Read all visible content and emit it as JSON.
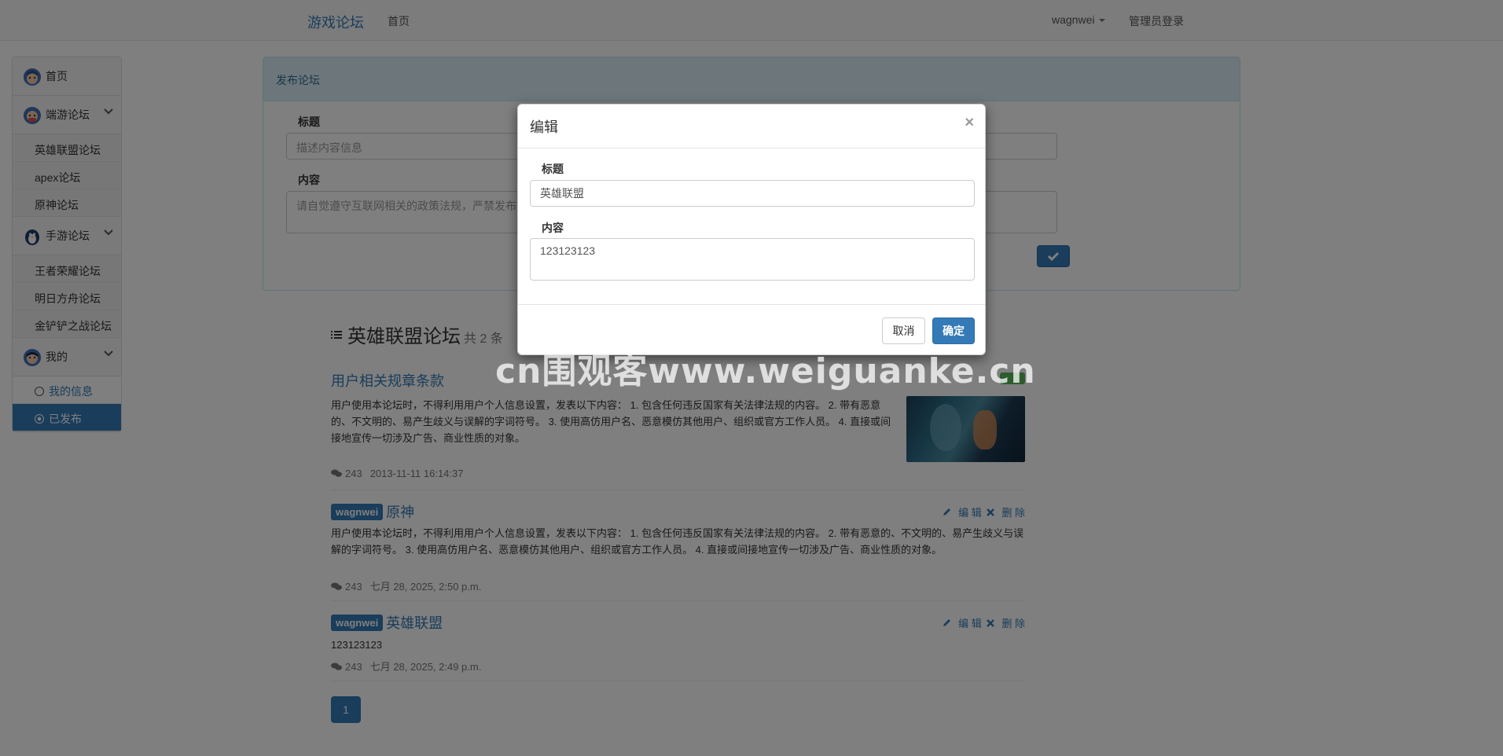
{
  "navbar": {
    "brand": "游戏论坛",
    "home": "首页",
    "user": "wagnwei",
    "admin_login": "管理员登录"
  },
  "sidebar": {
    "home": "首页",
    "pc_forum": "端游论坛",
    "pc_items": [
      "英雄联盟论坛",
      "apex论坛",
      "原神论坛"
    ],
    "mobile_forum": "手游论坛",
    "mobile_items": [
      "王者荣耀论坛",
      "明日方舟论坛",
      "金铲铲之战论坛"
    ],
    "mine": "我的",
    "mine_items": [
      "我的信息",
      "已发布"
    ]
  },
  "publish": {
    "header": "发布论坛",
    "title_label": "标题",
    "title_placeholder": "描述内容信息",
    "content_label": "内容",
    "content_placeholder": "请自觉遵守互联网相关的政策法规，严禁发布"
  },
  "list": {
    "title": "英雄联盟论坛",
    "count": "共 2 条",
    "posts": [
      {
        "title": "用户相关规章条款",
        "body": "用户使用本论坛时，不得利用用户个人信息设置，发表以下内容：   1. 包含任何违反国家有关法律法规的内容。    2. 带有恶意的、不文明的、易产生歧义与误解的字词符号。    3. 使用高仿用户名、恶意模仿其他用户、组织或官方工作人员。    4. 直接或间接地宣传一切涉及广告、商业性质的对象。",
        "comments": "243",
        "time": "2013-11-11 16:14:37"
      },
      {
        "author": "wagnwei",
        "title": "原神",
        "body": "用户使用本论坛时，不得利用用户个人信息设置，发表以下内容：   1. 包含任何违反国家有关法律法规的内容。    2. 带有恶意的、不文明的、易产生歧义与误解的字词符号。    3. 使用高仿用户名、恶意模仿其他用户、组织或官方工作人员。    4. 直接或间接地宣传一切涉及广告、商业性质的对象。",
        "comments": "243",
        "time": "七月 28, 2025, 2:50 p.m.",
        "edit": "编 辑",
        "delete": "删 除"
      },
      {
        "author": "wagnwei",
        "title": "英雄联盟",
        "body": "123123123",
        "comments": "243",
        "time": "七月 28, 2025, 2:49 p.m.",
        "edit": "编 辑",
        "delete": "删 除"
      }
    ],
    "page": "1"
  },
  "modal": {
    "title": "编辑",
    "close": "×",
    "title_label": "标题",
    "title_value": "英雄联盟",
    "content_label": "内容",
    "content_value": "123123123",
    "cancel": "取消",
    "confirm": "确定"
  },
  "watermark": "cn围观客www.weiguanke.cn",
  "colors": {
    "primary": "#337ab7",
    "panel_header": "#d9edf7",
    "success": "#5cb85c"
  }
}
